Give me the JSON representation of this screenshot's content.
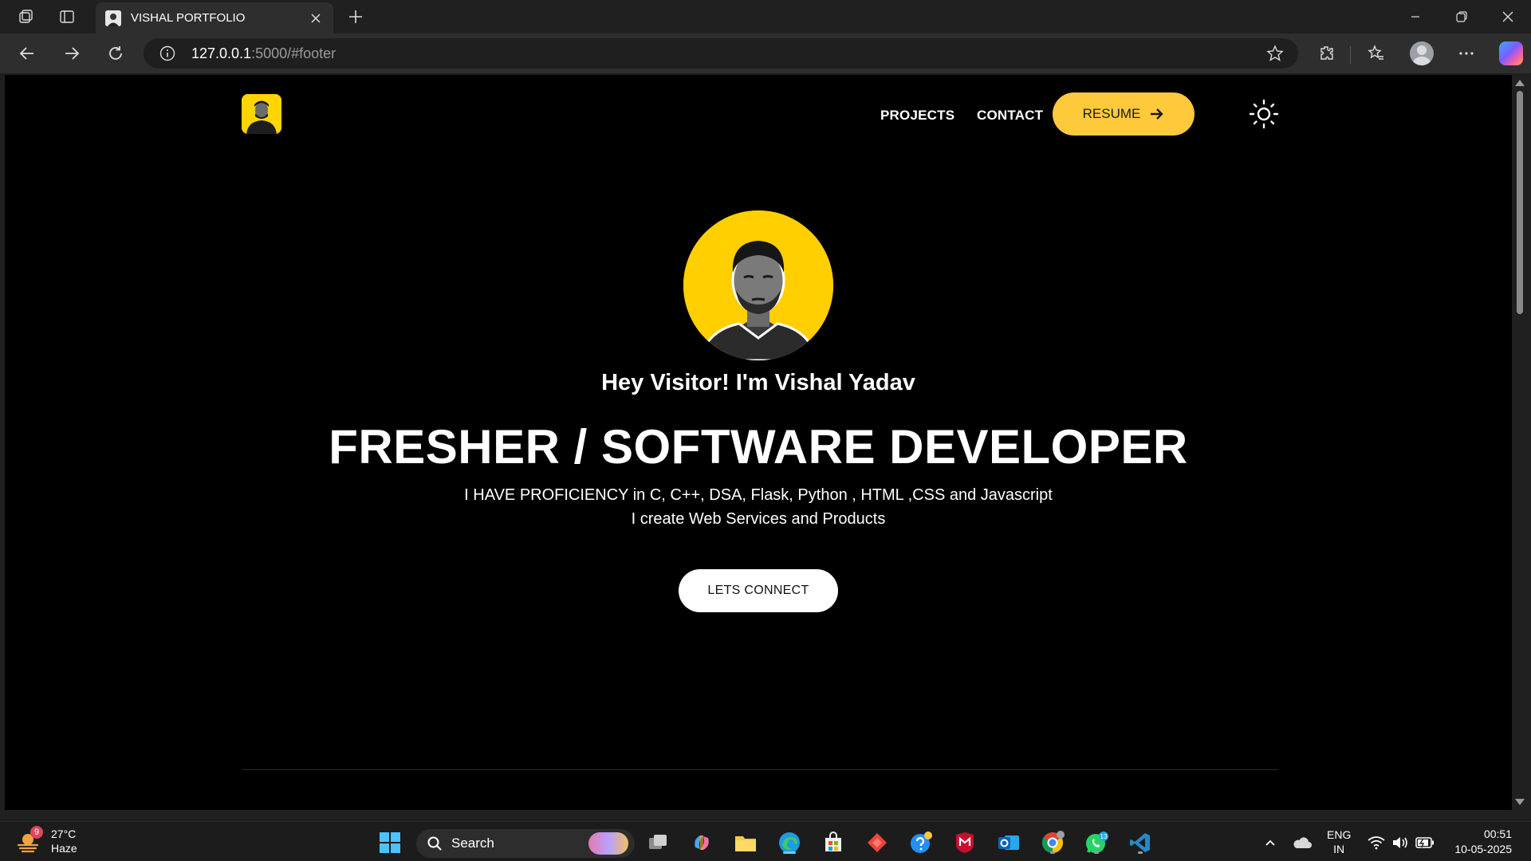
{
  "browser": {
    "tab_title": "VISHAL PORTFOLIO",
    "url_host": "127.0.0.1",
    "url_rest": ":5000/#footer"
  },
  "site": {
    "nav": {
      "projects": "PROJECTS",
      "contact": "CONTACT",
      "resume": "RESUME"
    },
    "hero": {
      "greeting": "Hey Visitor! I'm Vishal Yadav",
      "headline": "FRESHER / SOFTWARE DEVELOPER",
      "line1": "I HAVE PROFICIENCY in C, C++, DSA, Flask, Python , HTML ,CSS and Javascript",
      "line2": "I create Web Services and Products",
      "cta": "LETS CONNECT"
    },
    "colors": {
      "accent": "#ffc93c",
      "avatar_bg": "#ffcf00",
      "page_bg": "#000000"
    }
  },
  "taskbar": {
    "weather_badge": "9",
    "temperature": "27°C",
    "condition": "Haze",
    "search_label": "Search",
    "chrome_badge": "",
    "whatsapp_badge": "13",
    "lang": "ENG",
    "region": "IN",
    "time": "00:51",
    "date": "10-05-2025"
  }
}
